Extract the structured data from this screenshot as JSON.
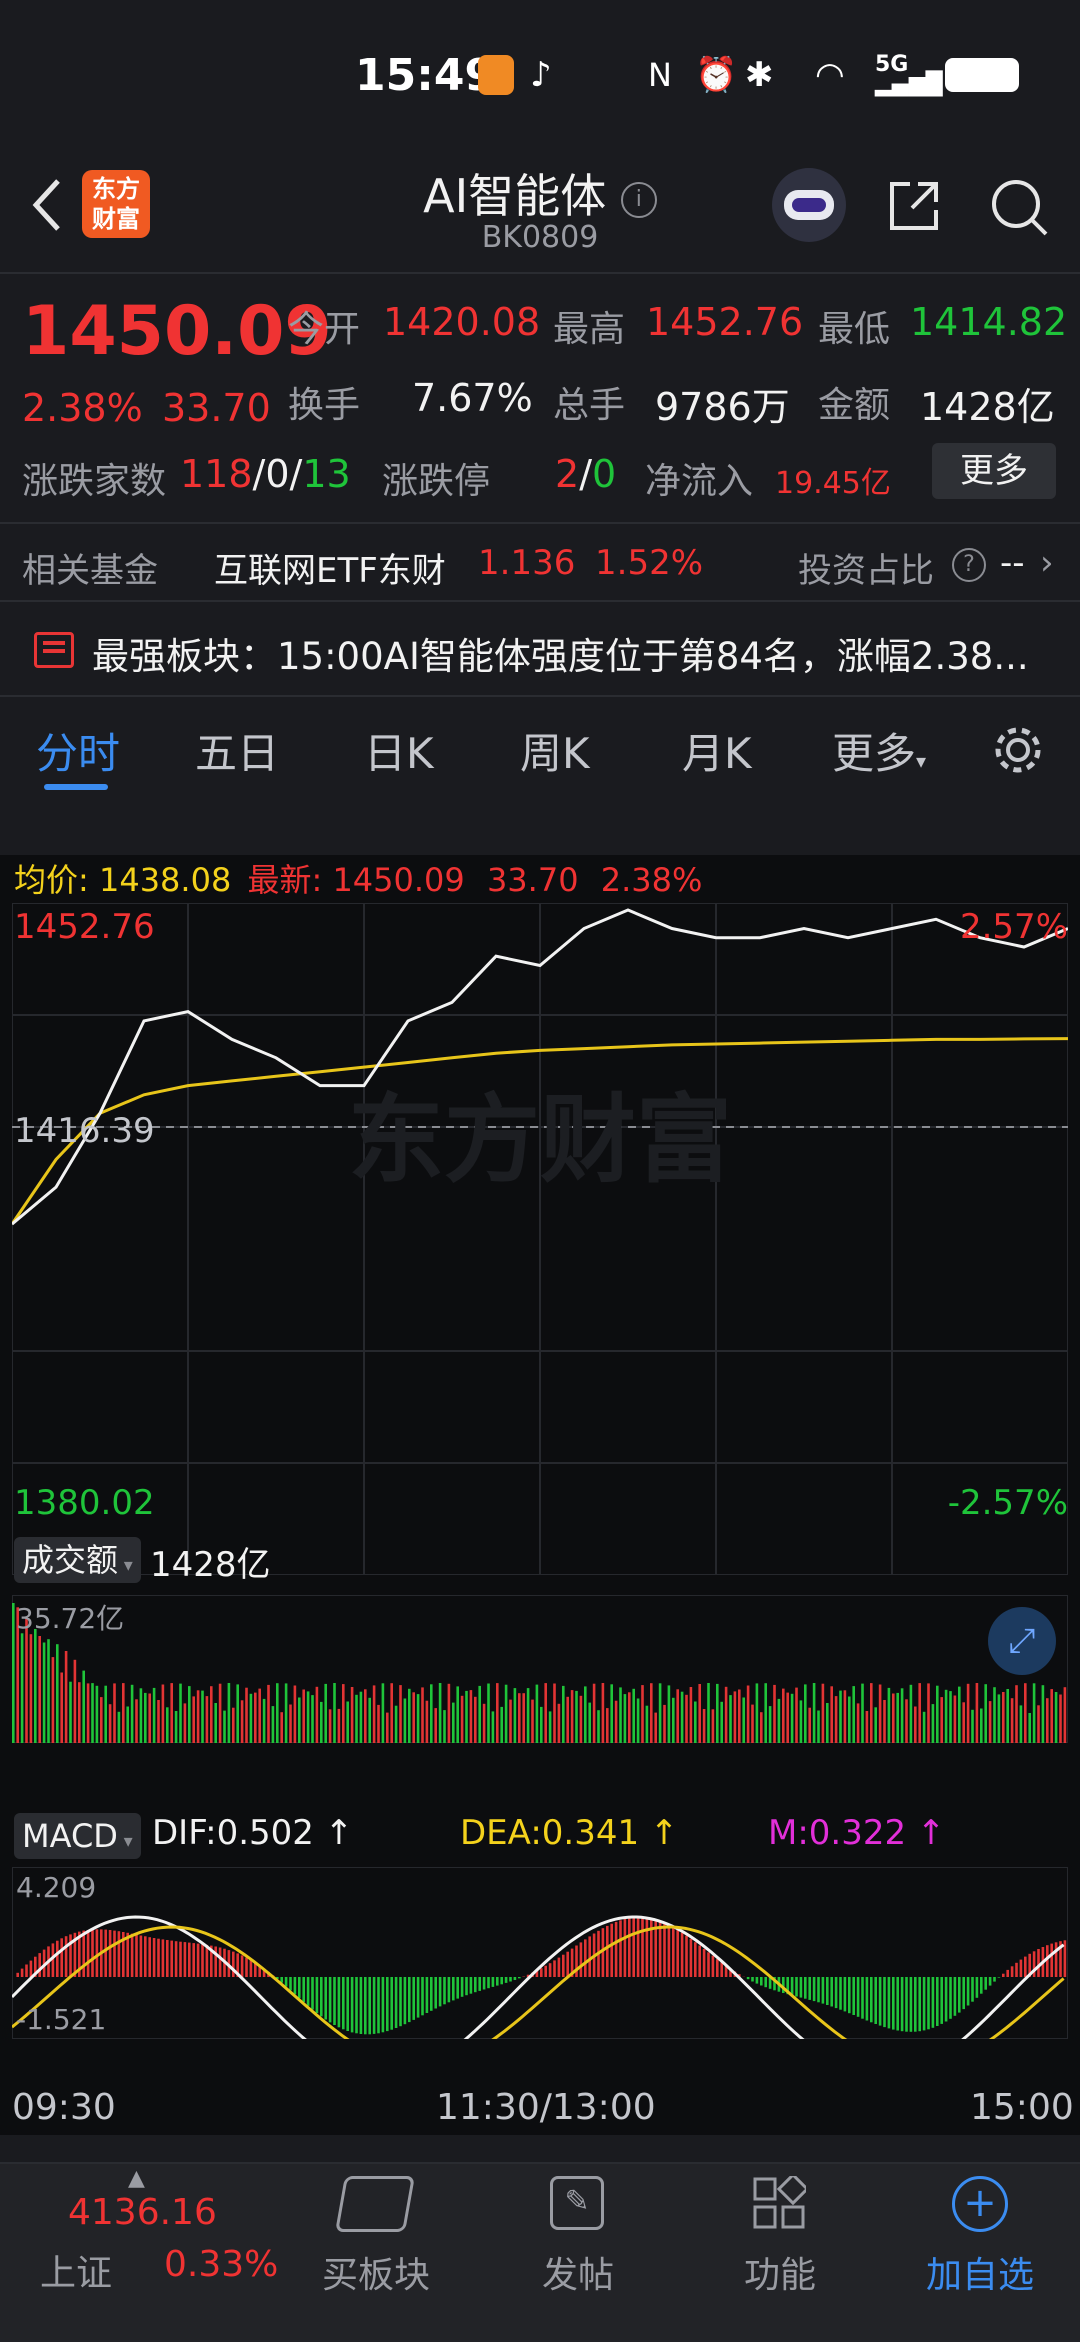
{
  "status_bar": {
    "time": "15:49",
    "network": "5G"
  },
  "header": {
    "logo_text": "东方财富",
    "title": "AI智能体",
    "code": "BK0809"
  },
  "quote": {
    "price": "1450.09",
    "change_pct": "2.38%",
    "change": "33.70",
    "open_label": "今开",
    "open": "1420.08",
    "high_label": "最高",
    "high": "1452.76",
    "low_label": "最低",
    "low": "1414.82",
    "turnover_label": "换手",
    "turnover": "7.67%",
    "volume_label": "总手",
    "volume": "9786万",
    "amount_label": "金额",
    "amount": "1428亿",
    "breadth_label": "涨跌家数",
    "up_count": "118",
    "flat_count": "0",
    "down_count": "13",
    "sep": "/",
    "limit_label": "涨跌停",
    "limit_up": "2",
    "limit_down": "0",
    "netflow_label": "净流入",
    "netflow": "19.45亿",
    "more_button": "更多"
  },
  "fund_row": {
    "label": "相关基金",
    "fund_name": "互联网ETF东财",
    "fund_price": "1.136",
    "fund_pct": "1.52%",
    "ratio_label": "投资占比",
    "ratio_value": "--"
  },
  "news": {
    "text": "最强板块：15:00AI智能体强度位于第84名，涨幅2.38..."
  },
  "tabs": [
    "分时",
    "五日",
    "日K",
    "周K",
    "月K",
    "更多"
  ],
  "active_tab": "分时",
  "chart_header": {
    "avg_label": "均价:",
    "avg_value": "1438.08",
    "last_label": "最新:",
    "last_value": "1450.09",
    "change": "33.70",
    "pct": "2.38%"
  },
  "price_axis": {
    "top": "1452.76",
    "top_pct": "2.57%",
    "mid": "1416.39",
    "bottom": "1380.02",
    "bottom_pct": "-2.57%"
  },
  "watermark": "东方财富",
  "volume_panel": {
    "label": "成交额",
    "total": "1428亿",
    "max": "35.72亿"
  },
  "macd_panel": {
    "label": "MACD",
    "dif": "DIF:0.502",
    "dea": "DEA:0.341",
    "m": "M:0.322",
    "top": "4.209",
    "bottom": "-1.521"
  },
  "time_axis": {
    "start": "09:30",
    "mid": "11:30/13:00",
    "end": "15:00"
  },
  "bottom_nav": {
    "index_value": "4136.16",
    "index_name": "上证",
    "index_pct": "0.33%",
    "items": [
      "买板块",
      "发帖",
      "功能",
      "加自选"
    ]
  },
  "chart_data": {
    "type": "line",
    "title": "",
    "series": [
      {
        "name": "最新",
        "values": [
          1418,
          1422,
          1430,
          1440,
          1441,
          1438,
          1436,
          1433,
          1433,
          1440,
          1442,
          1447,
          1446,
          1450,
          1452,
          1450,
          1449,
          1449,
          1450,
          1449,
          1450,
          1451,
          1449,
          1448,
          1450
        ]
      },
      {
        "name": "均价",
        "values": [
          1418,
          1425,
          1430,
          1432,
          1433,
          1433.5,
          1434,
          1434.5,
          1435,
          1435.5,
          1436,
          1436.5,
          1436.8,
          1437,
          1437.2,
          1437.4,
          1437.5,
          1437.6,
          1437.7,
          1437.8,
          1437.9,
          1438,
          1438,
          1438.05,
          1438.08
        ]
      }
    ],
    "ylim": [
      1380.02,
      1452.76
    ],
    "xlabel": "",
    "ylabel": ""
  }
}
